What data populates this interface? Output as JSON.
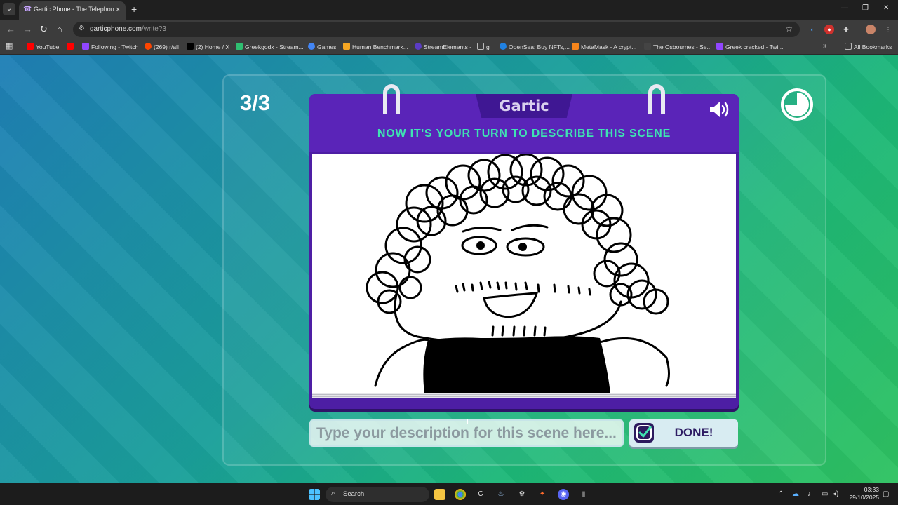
{
  "browser": {
    "tab": {
      "title": "Gartic Phone - The Telephone G",
      "favicon": "phone-icon",
      "close": "×"
    },
    "new_tab": "+",
    "window_controls": {
      "minimize": "—",
      "maximize": "❐",
      "close": "✕"
    },
    "address": {
      "host": "garticphone.com",
      "path": "/write?3"
    },
    "bookmarks": [
      {
        "label": "YouTube",
        "color": "#ff0000"
      },
      {
        "label": "",
        "color": "#ff0000"
      },
      {
        "label": "Following - Twitch",
        "color": "#9146ff"
      },
      {
        "label": "(269) r/all",
        "color": "#ff4500"
      },
      {
        "label": "(2) Home / X",
        "color": "#000000"
      },
      {
        "label": "Greekgodx - Stream...",
        "color": "#2fbf71"
      },
      {
        "label": "Games",
        "color": "#4285f4"
      },
      {
        "label": "Human Benchmark...",
        "color": "#f5a623"
      },
      {
        "label": "StreamElements -",
        "color": "#5b3cc4"
      },
      {
        "label": "g",
        "color": "#8a8a8a"
      },
      {
        "label": "OpenSea: Buy NFTs,...",
        "color": "#2081e2"
      },
      {
        "label": "MetaMask - A crypt...",
        "color": "#f6851b"
      },
      {
        "label": "The Osbournes - Se...",
        "color": "#222222"
      },
      {
        "label": "Greek cracked - Twi...",
        "color": "#9146ff"
      }
    ],
    "all_bookmarks": "All Bookmarks",
    "more_bookmarks": "»"
  },
  "game": {
    "round": "3/3",
    "logo": "Gartic",
    "prompt": "NOW IT'S YOUR TURN TO DESCRIBE THIS SCENE",
    "input_placeholder": "Type your description for this scene here...",
    "input_value": "",
    "done_label": "DONE!",
    "colors": {
      "notebook": "#4d1ea4",
      "prompt": "#3fe3b2",
      "done_text": "#2d1c63"
    }
  },
  "taskbar": {
    "search": "Search",
    "time": "03:33",
    "date": "29/10/2025"
  }
}
